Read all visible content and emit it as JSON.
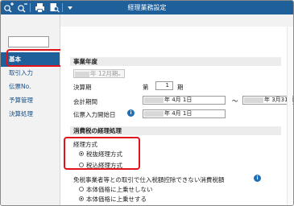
{
  "window": {
    "title": "経理業務設定",
    "toolbar_icons": [
      "zoom-in-icon",
      "zoom-out-icon",
      "print-icon",
      "print-preview-icon",
      "dropdown-icon"
    ]
  },
  "sidebar": {
    "items": [
      {
        "label": "基本",
        "selected": true
      },
      {
        "label": "取引入力",
        "selected": false
      },
      {
        "label": "伝票No.",
        "selected": false
      },
      {
        "label": "予算管理",
        "selected": false
      },
      {
        "label": "決算処理",
        "selected": false
      }
    ]
  },
  "main": {
    "fiscal_year_header": "事業年度",
    "era_select_suffix": "年 12月期",
    "settlement_label": "決算期",
    "settlement_prefix": "第",
    "settlement_value": "1",
    "settlement_suffix": "期",
    "period_label": "会計期間",
    "period_start": "年  4月 1日",
    "period_tilde": "〜",
    "period_end": "年  3月31日",
    "voucher_label": "伝票入力開始日",
    "voucher_date": "年  4月 1日",
    "tax_header": "消費税の経理処理",
    "method_title": "経理方式",
    "method_options": [
      {
        "label": "税抜経理方式",
        "selected": true
      },
      {
        "label": "税込経理方式",
        "selected": false
      }
    ],
    "exempt_title": "免税事業者等との取引で仕入税額控除できない消費税額",
    "exempt_options": [
      {
        "label": "本体価格に上乗せしない",
        "selected": false
      },
      {
        "label": "本体価格に上乗せする",
        "selected": true
      }
    ],
    "info_glyph": "i"
  },
  "colors": {
    "titlebar": "#1f5f9a",
    "highlight": "#e2121a",
    "nav_text": "#1b4f86",
    "info": "#1f6fb8"
  }
}
